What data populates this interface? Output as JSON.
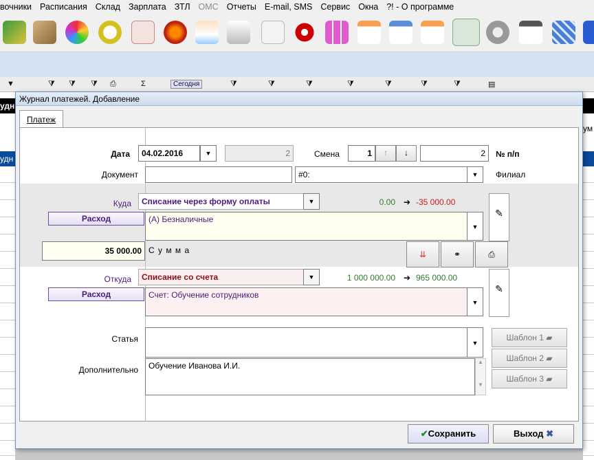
{
  "menu": [
    "вочники",
    "Расписания",
    "Склад",
    "Зарплата",
    "ЗТЛ",
    "ОМС",
    "Отчеты",
    "E-mail, SMS",
    "Сервис",
    "Окна",
    "?! - О программе"
  ],
  "bg": {
    "left_text_1": "удн",
    "left_text_2": "удн",
    "right_text": "ум",
    "filter_label": "Сегодня"
  },
  "dialog": {
    "title": "Журнал платежей. Добавление",
    "tab": "Платеж",
    "date_label": "Дата",
    "date_value": "04.02.2016",
    "num_value": "2",
    "shift_label": "Смена",
    "shift_value": "1",
    "num_pp_value": "2",
    "num_pp_label": "№ п/п",
    "doc_label": "Документ",
    "doc_value": "",
    "branch_value": "#0:",
    "branch_label": "Филиал",
    "to_label": "Куда",
    "to_value": "Списание через форму оплаты",
    "to_balance": "0.00",
    "to_new_balance": "-35 000.00",
    "to_type": "Расход",
    "to_account": "(А) Безналичные",
    "amount_value": "35 000.00",
    "amount_label": "С у м м а",
    "from_label": "Откуда",
    "from_value": "Списание со счета",
    "from_balance": "1 000 000.00",
    "from_new_balance": "965 000.00",
    "from_type": "Расход",
    "from_account": "Счет: Обучение сотрудников",
    "article_label": "Статья",
    "article_value": "",
    "extra_label": "Дополнительно",
    "extra_value": "Обучение Иванова И.И.",
    "template1": "Шаблон 1",
    "template2": "Шаблон 2",
    "template3": "Шаблон 3",
    "save_label": "Сохранить",
    "exit_label": "Выход"
  },
  "colors": {
    "accent_purple": "#4b1a7a",
    "balance_green": "#2f7d2f",
    "balance_red": "#d21a1a",
    "underline_red": "#e0392b"
  }
}
